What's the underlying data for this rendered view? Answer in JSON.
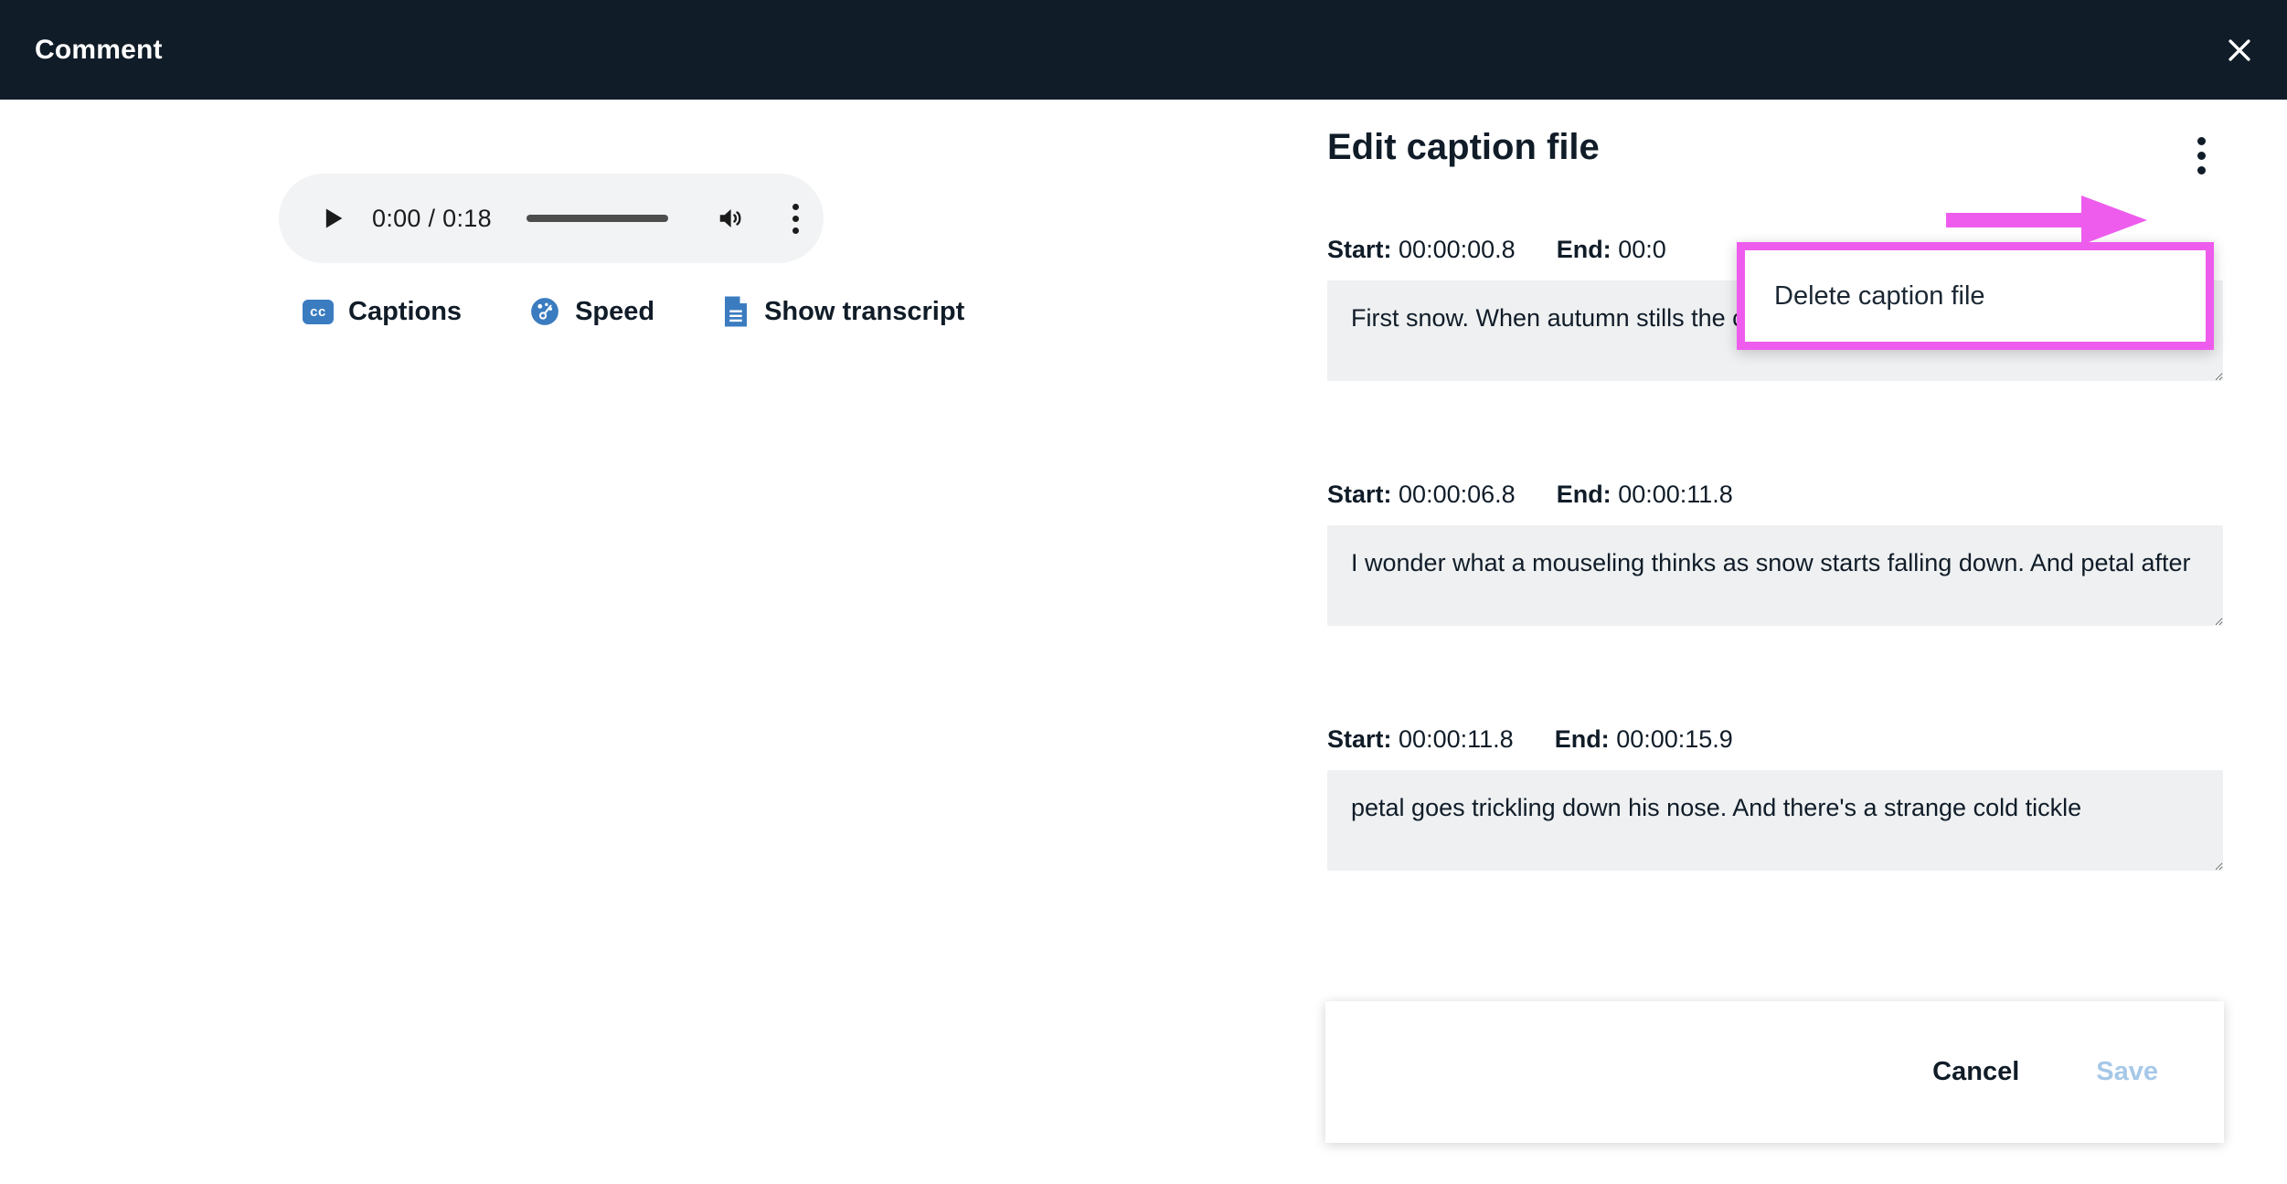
{
  "header": {
    "title": "Comment",
    "close_label": "Close",
    "background": "#101c28"
  },
  "player": {
    "play_label": "Play",
    "time": "0:00 / 0:18",
    "current_time": "0:00",
    "duration": "0:18",
    "progress_percent": 0,
    "volume_label": "Volume",
    "more_label": "More options",
    "options": [
      {
        "icon": "cc-icon",
        "icon_text": "cc",
        "label": "Captions"
      },
      {
        "icon": "speed-icon",
        "label": "Speed"
      },
      {
        "icon": "transcript-icon",
        "label": "Show transcript"
      }
    ]
  },
  "editor": {
    "title": "Edit caption file",
    "more_label": "More options",
    "labels": {
      "start": "Start:",
      "end": "End:"
    },
    "captions": [
      {
        "start": "00:00:00.8",
        "end": "00:0",
        "text": "First snow. When autumn stills the crickets and yellow leaves turn brown."
      },
      {
        "start": "00:00:06.8",
        "end": "00:00:11.8",
        "text": "I wonder what a mouseling thinks as snow starts falling down. And petal after"
      },
      {
        "start": "00:00:11.8",
        "end": "00:00:15.9",
        "text": "petal goes trickling down his nose. And there's a strange cold tickle"
      }
    ],
    "footer": {
      "cancel_label": "Cancel",
      "save_label": "Save"
    }
  },
  "menu": {
    "items": [
      {
        "label": "Delete caption file"
      }
    ]
  },
  "annotation": {
    "color": "#ee5ced",
    "arrow_direction": "right",
    "target": "editor-more-options"
  },
  "colors": {
    "header_bg": "#101c28",
    "accent_blue": "#3b7cc0",
    "textarea_bg": "#eef0f1",
    "save_disabled": "#a6c8e8",
    "annotation_pink": "#ee5ced"
  }
}
